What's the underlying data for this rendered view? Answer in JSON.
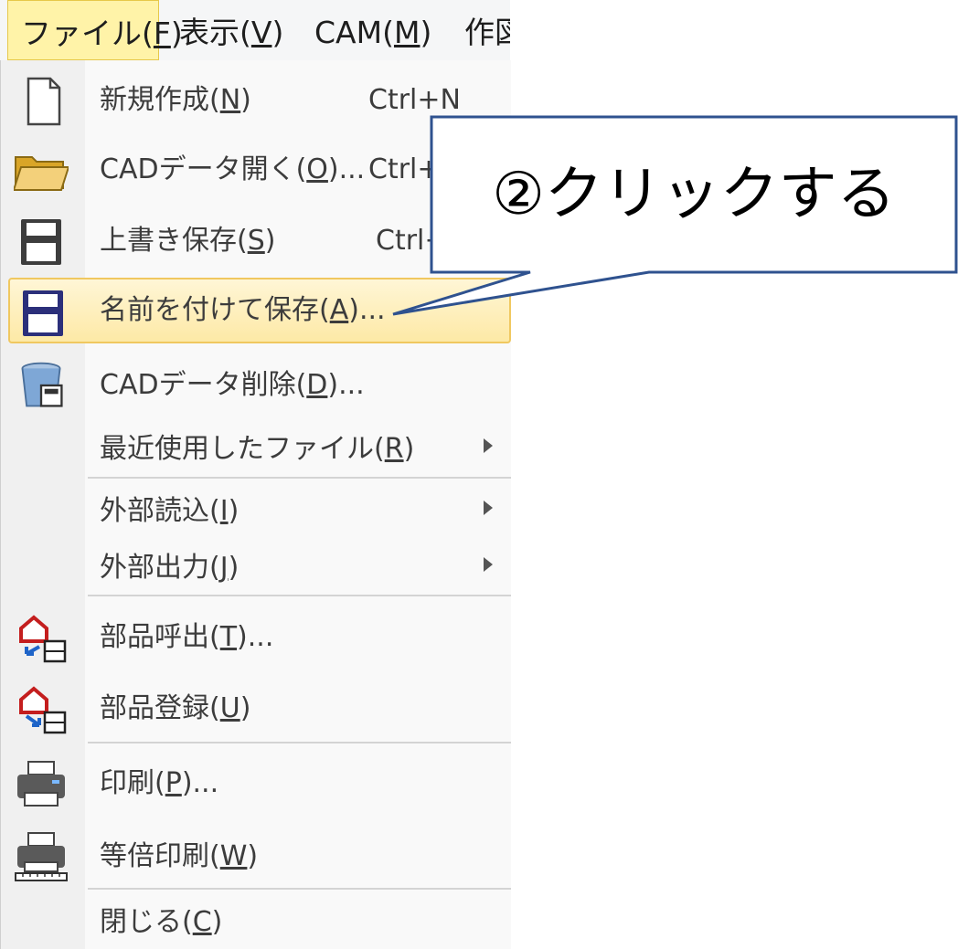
{
  "menubar": {
    "items": [
      {
        "label": "ファイル(",
        "key": "F",
        "close": ")"
      },
      {
        "label": "表示(",
        "key": "V",
        "close": ")"
      },
      {
        "label": "CAM(",
        "key": "M",
        "close": ")"
      },
      {
        "label": "作図"
      }
    ]
  },
  "menu": {
    "items": [
      {
        "label": "新規作成(",
        "key": "N",
        "close": ")",
        "shortcut": "Ctrl+N"
      },
      {
        "label": "CADデータ開く(",
        "key": "O",
        "close": ")...",
        "shortcut": "Ctrl+"
      },
      {
        "label": "上書き保存(",
        "key": "S",
        "close": ")",
        "shortcut": "Ctrl+"
      },
      {
        "label": "名前を付けて保存(",
        "key": "A",
        "close": ")..."
      },
      {
        "label": "CADデータ削除(",
        "key": "D",
        "close": ")..."
      },
      {
        "label": "最近使用したファイル(",
        "key": "R",
        "close": ")"
      },
      {
        "label": "外部読込(",
        "key": "I",
        "close": ")"
      },
      {
        "label": "外部出力(",
        "key": "J",
        "close": ")"
      },
      {
        "label": "部品呼出(",
        "key": "T",
        "close": ")..."
      },
      {
        "label": "部品登録(",
        "key": "U",
        "close": ")"
      },
      {
        "label": "印刷(",
        "key": "P",
        "close": ")..."
      },
      {
        "label": "等倍印刷(",
        "key": "W",
        "close": ")"
      },
      {
        "label": "閉じる(",
        "key": "C",
        "close": ")"
      }
    ]
  },
  "callout": {
    "text": "②クリックする"
  },
  "colors": {
    "highlight": "#fde9a6",
    "callout_border": "#2f528f",
    "menu_active": "#fff3a8"
  }
}
